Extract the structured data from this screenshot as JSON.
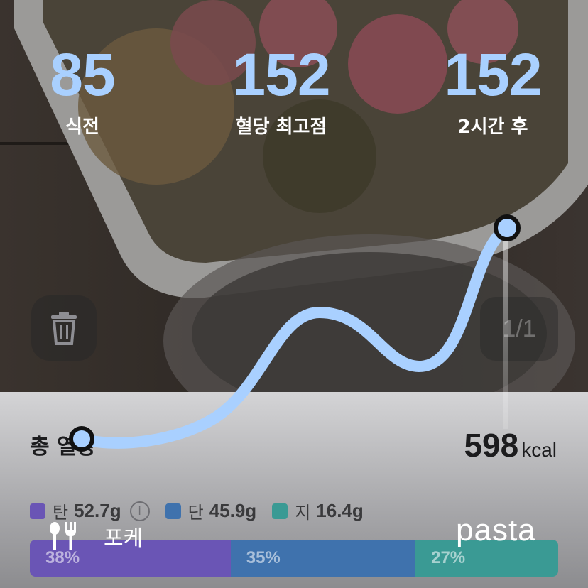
{
  "stats": [
    {
      "value": "85",
      "label": "식전"
    },
    {
      "value": "152",
      "label": "혈당 최고점"
    },
    {
      "value": "152",
      "label": "2시간 후"
    }
  ],
  "page_indicator": "1/1",
  "summary": {
    "title": "총 열량",
    "kcal_value": "598",
    "kcal_unit": "kcal"
  },
  "macros": [
    {
      "name": "탄",
      "amount": "52.7g",
      "color": "#6a55b5",
      "percent": "38%",
      "percent_value": 38,
      "has_info": true
    },
    {
      "name": "단",
      "amount": "45.9g",
      "color": "#3f72ad",
      "percent": "35%",
      "percent_value": 35,
      "has_info": false
    },
    {
      "name": "지",
      "amount": "16.4g",
      "color": "#3a9a94",
      "percent": "27%",
      "percent_value": 27,
      "has_info": false
    }
  ],
  "food": {
    "name": "포케",
    "icon": "fork-knife-icon"
  },
  "brand": "pasta",
  "icons": {
    "trash": "trash-icon"
  },
  "colors": {
    "accent": "#a9d0ff",
    "curve": "#a9d0ff"
  }
}
